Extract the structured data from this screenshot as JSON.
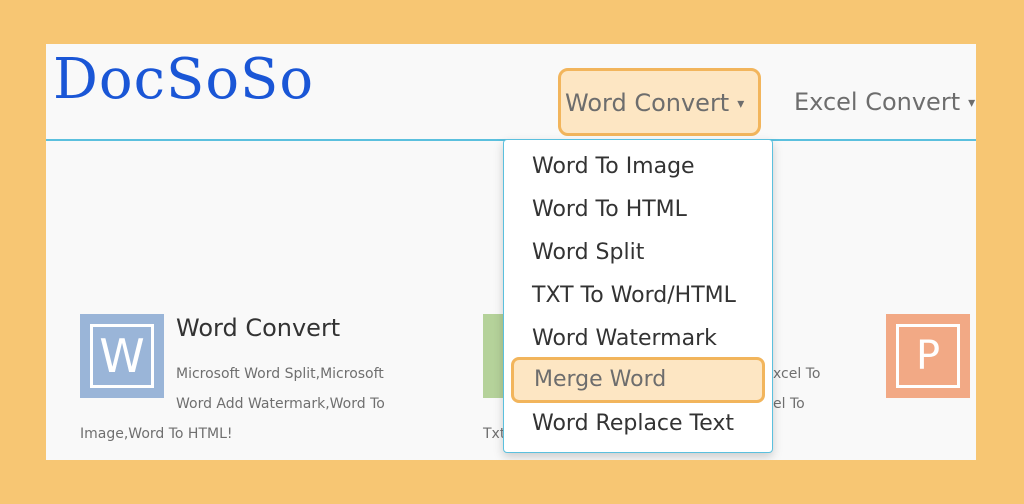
{
  "logo": {
    "text": "DocSoSo"
  },
  "nav": {
    "word_convert": "Word Convert",
    "excel_convert": "Excel Convert",
    "caret": "▾"
  },
  "dropdown": {
    "items": [
      "Word To Image",
      "Word To HTML",
      "Word Split",
      "TXT To Word/HTML",
      "Word Watermark",
      "Merge Word",
      "Word Replace Text"
    ],
    "highlighted": "Merge Word"
  },
  "cards": {
    "word": {
      "icon_letter": "W",
      "title": "Word Convert",
      "desc_line1": "Microsoft Word Split,Microsoft",
      "desc_line2": "Word Add Watermark,Word To",
      "desc_line3": "Image,Word To HTML!"
    },
    "excel": {
      "partial_line1": "xcel To",
      "partial_line2": "el To",
      "partial_line3": "Txt"
    },
    "ppt": {
      "icon_letter": "P"
    }
  },
  "colors": {
    "highlight_bg": "#fde6c3",
    "highlight_border": "#f2b55c",
    "logo": "#1a56d6",
    "header_rule": "#5bc0de"
  }
}
